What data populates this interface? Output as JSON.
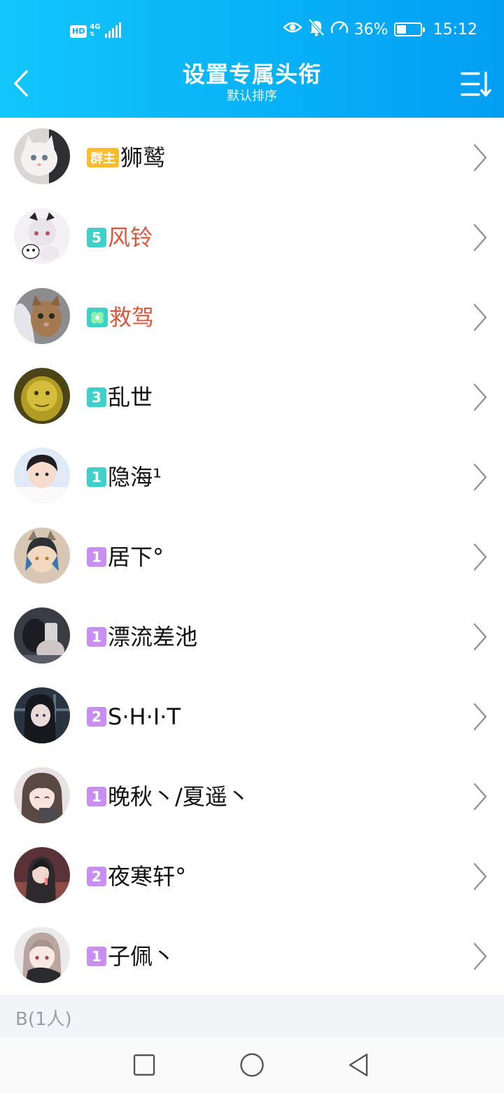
{
  "status_bar": {
    "hd_label": "HD",
    "net_type": "4G",
    "signal_icon": "signal-bars-icon",
    "battery_percent": "36%",
    "battery_level": 0.36,
    "time": "15:12"
  },
  "header": {
    "title": "设置专属头衔",
    "subtitle": "默认排序"
  },
  "members": [
    {
      "badge": "群主",
      "badge_color": "#fdbc2b",
      "name": "狮鹫",
      "name_color": "#111111"
    },
    {
      "badge": "5",
      "badge_color": "#3fd0c9",
      "name": "风铃",
      "name_color": "#d9573c"
    },
    {
      "badge": "",
      "badge_color": "#3fd0c9",
      "name": "救驾",
      "name_color": "#d9573c"
    },
    {
      "badge": "3",
      "badge_color": "#3fd0c9",
      "name": "乱世",
      "name_color": "#111111"
    },
    {
      "badge": "1",
      "badge_color": "#3fd0c9",
      "name": "隐海¹",
      "name_color": "#111111"
    },
    {
      "badge": "1",
      "badge_color": "#c98ff0",
      "name": "居下°",
      "name_color": "#111111"
    },
    {
      "badge": "1",
      "badge_color": "#c98ff0",
      "name": "漂流差池",
      "name_color": "#111111"
    },
    {
      "badge": "2",
      "badge_color": "#c98ff0",
      "name": "S·H·I·T",
      "name_color": "#111111"
    },
    {
      "badge": "1",
      "badge_color": "#c98ff0",
      "name": "晚秋丶/夏遥丶",
      "name_color": "#111111"
    },
    {
      "badge": "2",
      "badge_color": "#c98ff0",
      "name": "夜寒轩°",
      "name_color": "#111111"
    },
    {
      "badge": "1",
      "badge_color": "#c98ff0",
      "name": "子佩丶",
      "name_color": "#111111"
    }
  ],
  "section": {
    "label": "B(1人)"
  },
  "colors": {
    "header_gradient_start": "#12c6fb",
    "header_gradient_end": "#039ef3",
    "chevron": "#8a8f99"
  }
}
